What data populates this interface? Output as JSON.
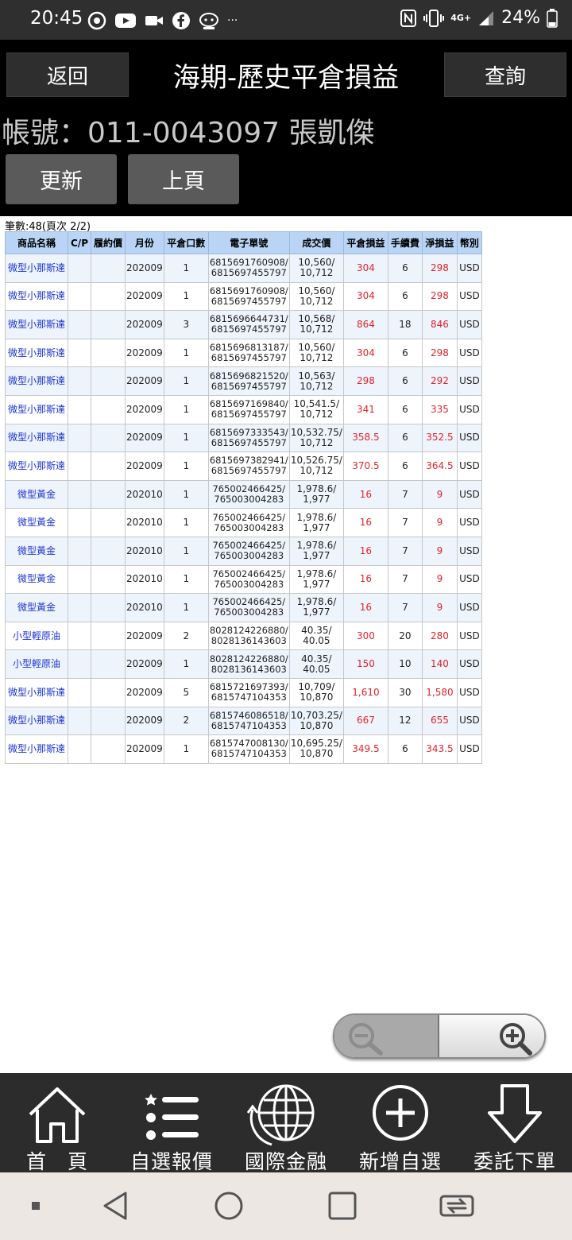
{
  "status_bar": {
    "time": "20:45",
    "battery": "24%",
    "network": "4G+",
    "more": "···",
    "icons": [
      "chrome-icon",
      "youtube-icon",
      "video-icon",
      "facebook-icon",
      "app-icon",
      "nfc-icon",
      "vibrate-icon",
      "signal-icon",
      "battery-icon"
    ]
  },
  "header": {
    "back_label": "返回",
    "title": "海期-歷史平倉損益",
    "query_label": "查詢",
    "account": "帳號：011-0043097 張凱傑",
    "refresh_label": "更新",
    "prev_label": "上頁"
  },
  "record_count": "筆數:48(頁次 2/2)",
  "table": {
    "headers": [
      "商品名稱",
      "C/P",
      "履約價",
      "月份",
      "平倉口數",
      "電子單號",
      "成交價",
      "平倉損益",
      "手續費",
      "淨損益",
      "幣別"
    ],
    "rows": [
      {
        "name": "微型小那斯達",
        "cp": "",
        "strike": "",
        "month": "202009",
        "qty": "1",
        "order1": "6815691760908/",
        "order2": "6815697455797",
        "price1": "10,560/",
        "price2": "10,712",
        "pnl": "304",
        "fee": "6",
        "net": "298",
        "cur": "USD"
      },
      {
        "name": "微型小那斯達",
        "cp": "",
        "strike": "",
        "month": "202009",
        "qty": "1",
        "order1": "6815691760908/",
        "order2": "6815697455797",
        "price1": "10,560/",
        "price2": "10,712",
        "pnl": "304",
        "fee": "6",
        "net": "298",
        "cur": "USD"
      },
      {
        "name": "微型小那斯達",
        "cp": "",
        "strike": "",
        "month": "202009",
        "qty": "3",
        "order1": "6815696644731/",
        "order2": "6815697455797",
        "price1": "10,568/",
        "price2": "10,712",
        "pnl": "864",
        "fee": "18",
        "net": "846",
        "cur": "USD"
      },
      {
        "name": "微型小那斯達",
        "cp": "",
        "strike": "",
        "month": "202009",
        "qty": "1",
        "order1": "6815696813187/",
        "order2": "6815697455797",
        "price1": "10,560/",
        "price2": "10,712",
        "pnl": "304",
        "fee": "6",
        "net": "298",
        "cur": "USD"
      },
      {
        "name": "微型小那斯達",
        "cp": "",
        "strike": "",
        "month": "202009",
        "qty": "1",
        "order1": "6815696821520/",
        "order2": "6815697455797",
        "price1": "10,563/",
        "price2": "10,712",
        "pnl": "298",
        "fee": "6",
        "net": "292",
        "cur": "USD"
      },
      {
        "name": "微型小那斯達",
        "cp": "",
        "strike": "",
        "month": "202009",
        "qty": "1",
        "order1": "6815697169840/",
        "order2": "6815697455797",
        "price1": "10,541.5/",
        "price2": "10,712",
        "pnl": "341",
        "fee": "6",
        "net": "335",
        "cur": "USD"
      },
      {
        "name": "微型小那斯達",
        "cp": "",
        "strike": "",
        "month": "202009",
        "qty": "1",
        "order1": "6815697333543/",
        "order2": "6815697455797",
        "price1": "10,532.75/",
        "price2": "10,712",
        "pnl": "358.5",
        "fee": "6",
        "net": "352.5",
        "cur": "USD"
      },
      {
        "name": "微型小那斯達",
        "cp": "",
        "strike": "",
        "month": "202009",
        "qty": "1",
        "order1": "6815697382941/",
        "order2": "6815697455797",
        "price1": "10,526.75/",
        "price2": "10,712",
        "pnl": "370.5",
        "fee": "6",
        "net": "364.5",
        "cur": "USD"
      },
      {
        "name": "微型黃金",
        "cp": "",
        "strike": "",
        "month": "202010",
        "qty": "1",
        "order1": "765002466425/",
        "order2": "765003004283",
        "price1": "1,978.6/",
        "price2": "1,977",
        "pnl": "16",
        "fee": "7",
        "net": "9",
        "cur": "USD"
      },
      {
        "name": "微型黃金",
        "cp": "",
        "strike": "",
        "month": "202010",
        "qty": "1",
        "order1": "765002466425/",
        "order2": "765003004283",
        "price1": "1,978.6/",
        "price2": "1,977",
        "pnl": "16",
        "fee": "7",
        "net": "9",
        "cur": "USD"
      },
      {
        "name": "微型黃金",
        "cp": "",
        "strike": "",
        "month": "202010",
        "qty": "1",
        "order1": "765002466425/",
        "order2": "765003004283",
        "price1": "1,978.6/",
        "price2": "1,977",
        "pnl": "16",
        "fee": "7",
        "net": "9",
        "cur": "USD"
      },
      {
        "name": "微型黃金",
        "cp": "",
        "strike": "",
        "month": "202010",
        "qty": "1",
        "order1": "765002466425/",
        "order2": "765003004283",
        "price1": "1,978.6/",
        "price2": "1,977",
        "pnl": "16",
        "fee": "7",
        "net": "9",
        "cur": "USD"
      },
      {
        "name": "微型黃金",
        "cp": "",
        "strike": "",
        "month": "202010",
        "qty": "1",
        "order1": "765002466425/",
        "order2": "765003004283",
        "price1": "1,978.6/",
        "price2": "1,977",
        "pnl": "16",
        "fee": "7",
        "net": "9",
        "cur": "USD"
      },
      {
        "name": "小型輕原油",
        "cp": "",
        "strike": "",
        "month": "202009",
        "qty": "2",
        "order1": "8028124226880/",
        "order2": "8028136143603",
        "price1": "40.35/",
        "price2": "40.05",
        "pnl": "300",
        "fee": "20",
        "net": "280",
        "cur": "USD"
      },
      {
        "name": "小型輕原油",
        "cp": "",
        "strike": "",
        "month": "202009",
        "qty": "1",
        "order1": "8028124226880/",
        "order2": "8028136143603",
        "price1": "40.35/",
        "price2": "40.05",
        "pnl": "150",
        "fee": "10",
        "net": "140",
        "cur": "USD"
      },
      {
        "name": "微型小那斯達",
        "cp": "",
        "strike": "",
        "month": "202009",
        "qty": "5",
        "order1": "6815721697393/",
        "order2": "6815747104353",
        "price1": "10,709/",
        "price2": "10,870",
        "pnl": "1,610",
        "fee": "30",
        "net": "1,580",
        "cur": "USD"
      },
      {
        "name": "微型小那斯達",
        "cp": "",
        "strike": "",
        "month": "202009",
        "qty": "2",
        "order1": "6815746086518/",
        "order2": "6815747104353",
        "price1": "10,703.25/",
        "price2": "10,870",
        "pnl": "667",
        "fee": "12",
        "net": "655",
        "cur": "USD"
      },
      {
        "name": "微型小那斯達",
        "cp": "",
        "strike": "",
        "month": "202009",
        "qty": "1",
        "order1": "6815747008130/",
        "order2": "6815747104353",
        "price1": "10,695.25/",
        "price2": "10,870",
        "pnl": "349.5",
        "fee": "6",
        "net": "343.5",
        "cur": "USD"
      }
    ]
  },
  "zoom": {
    "out_icon": "zoom-out-icon",
    "in_icon": "zoom-in-icon"
  },
  "bottom_nav": [
    {
      "label": "首　頁",
      "icon": "home-icon"
    },
    {
      "label": "自選報價",
      "icon": "list-icon"
    },
    {
      "label": "國際金融",
      "icon": "globe-icon"
    },
    {
      "label": "新增自選",
      "icon": "add-circle-icon"
    },
    {
      "label": "委託下單",
      "icon": "download-arrow-icon"
    }
  ],
  "system_nav": [
    "menu-dot-icon",
    "back-icon",
    "home-circle-icon",
    "recents-icon",
    "rotate-icon"
  ]
}
